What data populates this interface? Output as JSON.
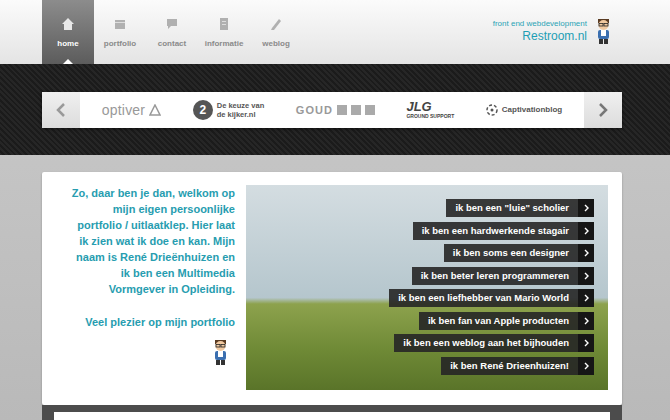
{
  "nav": {
    "items": [
      {
        "label": "home",
        "selected": true
      },
      {
        "label": "portfolio",
        "selected": false
      },
      {
        "label": "contact",
        "selected": false
      },
      {
        "label": "informatie",
        "selected": false
      },
      {
        "label": "weblog",
        "selected": false
      }
    ]
  },
  "brand": {
    "tagline": "front end webdevelopment",
    "name": "Restroom.nl"
  },
  "logos": {
    "optiver": "optiver",
    "keuze": {
      "number": "2",
      "line1": "De keuze van",
      "line2": "de kijker.nl"
    },
    "goud": "GOUD",
    "jlg": {
      "name": "JLG",
      "sub": "GROUND SUPPORT"
    },
    "captivation": "Captivationblog"
  },
  "intro": {
    "text": "Zo, daar ben je dan, welkom op mijn eigen persoonlijke portfolio / uitlaatklep. Hier laat ik zien wat ik doe en kan. Mijn naam is René Drieënhuizen en ik ben een Multimedia Vormgever in Opleiding.",
    "closing": "Veel plezier op mijn portfolio"
  },
  "hero": {
    "items": [
      "ik ben een \"luie\" scholier",
      "ik ben een hardwerkende stagair",
      "ik ben soms een designer",
      "ik ben beter leren programmeren",
      "ik ben een liefhebber van Mario World",
      "ik ben fan van Apple producten",
      "ik ben een weblog aan het bijhouden",
      "ik ben René Drieenhuizen!"
    ]
  }
}
